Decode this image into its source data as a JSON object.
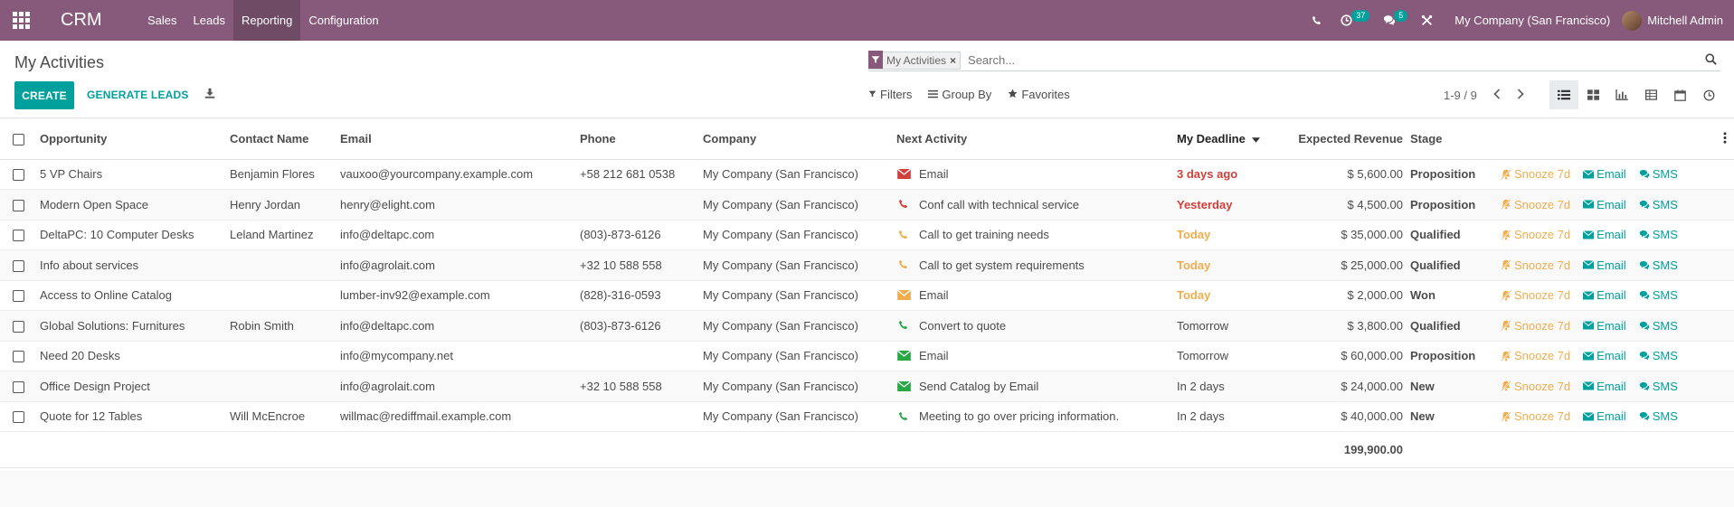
{
  "navbar": {
    "brand": "CRM",
    "menu": [
      "Sales",
      "Leads",
      "Reporting",
      "Configuration"
    ],
    "active_menu": "Reporting",
    "activity_count": "37",
    "message_count": "5",
    "company": "My Company (San Francisco)",
    "user": "Mitchell Admin"
  },
  "control_panel": {
    "breadcrumb": "My Activities",
    "create_label": "CREATE",
    "generate_label": "GENERATE LEADS",
    "facet_label": "My Activities",
    "facet_close": "×",
    "search_placeholder": "Search...",
    "filters_label": "Filters",
    "groupby_label": "Group By",
    "favorites_label": "Favorites",
    "pager": "1-9 / 9"
  },
  "table": {
    "headers": {
      "opportunity": "Opportunity",
      "contact": "Contact Name",
      "email": "Email",
      "phone": "Phone",
      "company": "Company",
      "activity": "Next Activity",
      "deadline": "My Deadline",
      "revenue": "Expected Revenue",
      "stage": "Stage"
    },
    "buttons": {
      "snooze": "Snooze 7d",
      "email": "Email",
      "sms": "SMS"
    },
    "rows": [
      {
        "opportunity": "5 VP Chairs",
        "contact": "Benjamin Flores",
        "email": "vauxoo@yourcompany.example.com",
        "phone": "+58 212 681 0538",
        "company": "My Company (San Francisco)",
        "activity_icon": "envelope-icon",
        "activity_color": "#d23f3a",
        "activity": "Email",
        "deadline": "3 days ago",
        "deadline_state": "overdue",
        "revenue": "$ 5,600.00",
        "stage": "Proposition"
      },
      {
        "opportunity": "Modern Open Space",
        "contact": "Henry Jordan",
        "email": "henry@elight.com",
        "phone": "",
        "company": "My Company (San Francisco)",
        "activity_icon": "phone-icon",
        "activity_color": "#d23f3a",
        "activity": "Conf call with technical service",
        "deadline": "Yesterday",
        "deadline_state": "overdue",
        "revenue": "$ 4,500.00",
        "stage": "Proposition"
      },
      {
        "opportunity": "DeltaPC: 10 Computer Desks",
        "contact": "Leland Martinez",
        "email": "info@deltapc.com",
        "phone": "(803)-873-6126",
        "company": "My Company (San Francisco)",
        "activity_icon": "phone-icon",
        "activity_color": "#f0ad4e",
        "activity": "Call to get training needs",
        "deadline": "Today",
        "deadline_state": "today",
        "revenue": "$ 35,000.00",
        "stage": "Qualified"
      },
      {
        "opportunity": "Info about services",
        "contact": "",
        "email": "info@agrolait.com",
        "phone": "+32 10 588 558",
        "company": "My Company (San Francisco)",
        "activity_icon": "phone-icon",
        "activity_color": "#f0ad4e",
        "activity": "Call to get system requirements",
        "deadline": "Today",
        "deadline_state": "today",
        "revenue": "$ 25,000.00",
        "stage": "Qualified"
      },
      {
        "opportunity": "Access to Online Catalog",
        "contact": "",
        "email": "lumber-inv92@example.com",
        "phone": "(828)-316-0593",
        "company": "My Company (San Francisco)",
        "activity_icon": "envelope-icon",
        "activity_color": "#f0ad4e",
        "activity": "Email",
        "deadline": "Today",
        "deadline_state": "today",
        "revenue": "$ 2,000.00",
        "stage": "Won"
      },
      {
        "opportunity": "Global Solutions: Furnitures",
        "contact": "Robin Smith",
        "email": "info@deltapc.com",
        "phone": "(803)-873-6126",
        "company": "My Company (San Francisco)",
        "activity_icon": "phone-icon",
        "activity_color": "#28a745",
        "activity": "Convert to quote",
        "deadline": "Tomorrow",
        "deadline_state": "planned",
        "revenue": "$ 3,800.00",
        "stage": "Qualified"
      },
      {
        "opportunity": "Need 20 Desks",
        "contact": "",
        "email": "info@mycompany.net",
        "phone": "",
        "company": "My Company (San Francisco)",
        "activity_icon": "envelope-icon",
        "activity_color": "#28a745",
        "activity": "Email",
        "deadline": "Tomorrow",
        "deadline_state": "planned",
        "revenue": "$ 60,000.00",
        "stage": "Proposition"
      },
      {
        "opportunity": "Office Design Project",
        "contact": "",
        "email": "info@agrolait.com",
        "phone": "+32 10 588 558",
        "company": "My Company (San Francisco)",
        "activity_icon": "envelope-icon",
        "activity_color": "#28a745",
        "activity": "Send Catalog by Email",
        "deadline": "In 2 days",
        "deadline_state": "planned",
        "revenue": "$ 24,000.00",
        "stage": "New"
      },
      {
        "opportunity": "Quote for 12 Tables",
        "contact": "Will McEncroe",
        "email": "willmac@rediffmail.example.com",
        "phone": "",
        "company": "My Company (San Francisco)",
        "activity_icon": "phone-icon",
        "activity_color": "#28a745",
        "activity": "Meeting to go over pricing information.",
        "deadline": "In 2 days",
        "deadline_state": "planned",
        "revenue": "$ 40,000.00",
        "stage": "New"
      }
    ],
    "total_revenue": "199,900.00"
  },
  "colors": {
    "brand": "#875a7b",
    "accent": "#00a09d",
    "overdue": "#d23f3a",
    "today": "#f0ad4e",
    "planned": "#28a745"
  }
}
